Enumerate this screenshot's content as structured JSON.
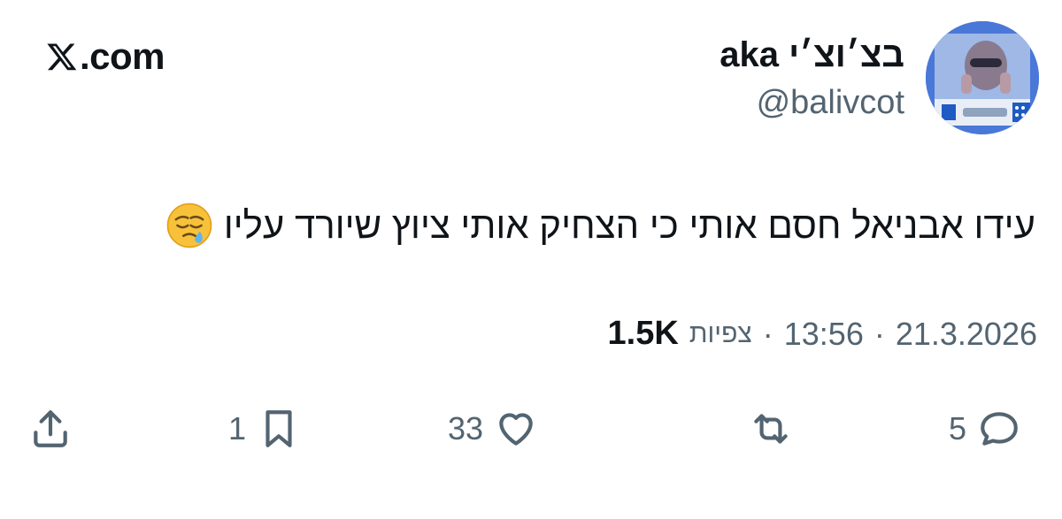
{
  "site": {
    "domain": ".com",
    "logo_icon": "x-logo-icon"
  },
  "author": {
    "display_name": "בצ׳וצ׳י aka",
    "handle": "@balivcot"
  },
  "tweet": {
    "text": "עידו אבניאל חסם אותי כי הצחיק אותי ציוץ שיורד עליו",
    "emoji": "sleepy-face-emoji"
  },
  "meta": {
    "date": "21.3.2026",
    "separator": "·",
    "time": "13:56",
    "views_label": "צפיות",
    "views_count": "1.5K"
  },
  "actions": {
    "reply_count": "5",
    "repost_count": "",
    "like_count": "33",
    "bookmark_count": "1"
  },
  "colors": {
    "text": "#0f1419",
    "secondary": "#536471",
    "background": "#ffffff"
  }
}
